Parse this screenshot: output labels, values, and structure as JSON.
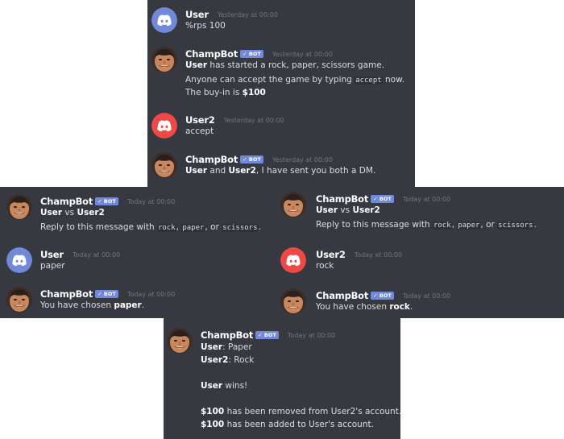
{
  "labels": {
    "bot_badge": "✓ BOT"
  },
  "panel1": {
    "messages": [
      {
        "author": "User",
        "time": "Yesterday at 00:00",
        "lines": [
          [
            "%rps 100"
          ]
        ]
      },
      {
        "author": "ChampBot",
        "time": "Yesterday at 00:00",
        "lines": [
          [
            {
              "b": "User"
            },
            " has started a rock, paper, scissors game."
          ],
          [
            "Anyone can accept the game by typing ",
            {
              "code": "accept"
            },
            " now."
          ],
          [
            "The buy-in is ",
            {
              "b": "$100"
            }
          ]
        ]
      },
      {
        "author": "User2",
        "time": "Yesterday at 00:00",
        "lines": [
          [
            "accept"
          ]
        ]
      },
      {
        "author": "ChampBot",
        "time": "Yesterday at 00:00",
        "lines": [
          [
            {
              "b": "User"
            },
            " and ",
            {
              "b": "User2"
            },
            ", I have sent you both a DM."
          ]
        ]
      }
    ]
  },
  "panel2": {
    "messages": [
      {
        "author": "ChampBot",
        "time": "Today at 00:00",
        "lines": [
          [
            {
              "b": "User"
            },
            " vs ",
            {
              "b": "User2"
            }
          ],
          [
            "Reply to this message with ",
            {
              "code": "rock"
            },
            ", ",
            {
              "code": "paper"
            },
            ", or ",
            {
              "code": "scissors"
            },
            "."
          ]
        ]
      },
      {
        "author": "User",
        "time": "Today at 00:00",
        "lines": [
          [
            "paper"
          ]
        ]
      },
      {
        "author": "ChampBot",
        "time": "Today at 00:00",
        "lines": [
          [
            "You have chosen ",
            {
              "b": "paper"
            },
            "."
          ]
        ]
      }
    ]
  },
  "panel3": {
    "messages": [
      {
        "author": "ChampBot",
        "time": "Today at 00:00",
        "lines": [
          [
            {
              "b": "User"
            },
            " vs ",
            {
              "b": "User2"
            }
          ],
          [
            "Reply to this message with ",
            {
              "code": "rock"
            },
            ", ",
            {
              "code": "paper"
            },
            ", or ",
            {
              "code": "scissors"
            },
            "."
          ]
        ]
      },
      {
        "author": "User2",
        "time": "Today at 00:00",
        "lines": [
          [
            "rock"
          ]
        ]
      },
      {
        "author": "ChampBot",
        "time": "Today at 00:00",
        "lines": [
          [
            "You have chosen ",
            {
              "b": "rock"
            },
            "."
          ]
        ]
      }
    ]
  },
  "panel4": {
    "messages": [
      {
        "author": "ChampBot",
        "time": "Today at 00:00",
        "lines": [
          [
            {
              "b": "User"
            },
            ": Paper"
          ],
          [
            {
              "b": "User2"
            },
            ": Rock"
          ],
          [
            ""
          ],
          [
            {
              "b": "User"
            },
            " wins!"
          ],
          [
            ""
          ],
          [
            {
              "b": "$100"
            },
            " has been removed from User2's account."
          ],
          [
            {
              "b": "$100"
            },
            " has been added to User's account."
          ]
        ]
      }
    ]
  },
  "colors": {
    "background": "#36393f",
    "user_avatar": "#7289da",
    "user2_avatar": "#f04747",
    "bot_badge": "#7289da"
  }
}
